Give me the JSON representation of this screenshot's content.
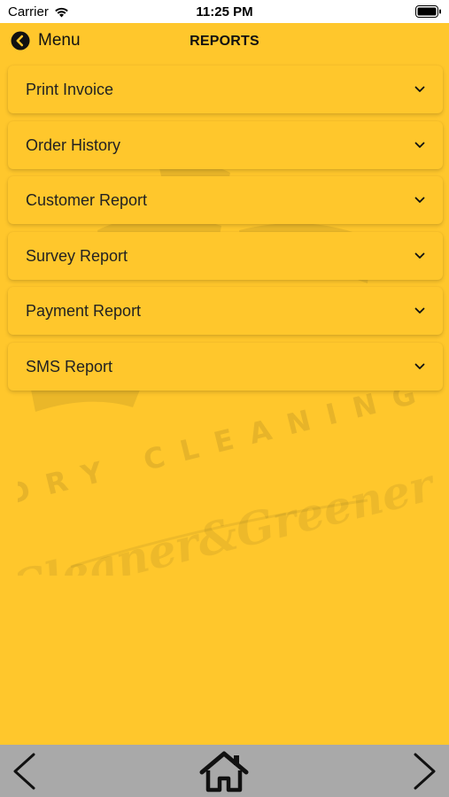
{
  "status_bar": {
    "carrier": "Carrier",
    "time": "11:25 PM"
  },
  "nav": {
    "back_label": "Menu",
    "title": "REPORTS"
  },
  "reports": [
    {
      "label": "Print Invoice"
    },
    {
      "label": "Order History"
    },
    {
      "label": "Customer Report"
    },
    {
      "label": "Survey Report"
    },
    {
      "label": "Payment Report"
    },
    {
      "label": "SMS Report"
    }
  ],
  "watermark": {
    "line1": "DRY CLEANING",
    "line2": "Cleaner&Greener!"
  },
  "colors": {
    "background": "#ffc72c",
    "toolbar": "#a9a9a9",
    "text": "#222222"
  },
  "icons": {
    "back": "chevron-left-circle-icon",
    "expand": "chevron-down-icon",
    "prev": "chevron-left-icon",
    "home": "home-icon",
    "next": "chevron-right-icon"
  }
}
